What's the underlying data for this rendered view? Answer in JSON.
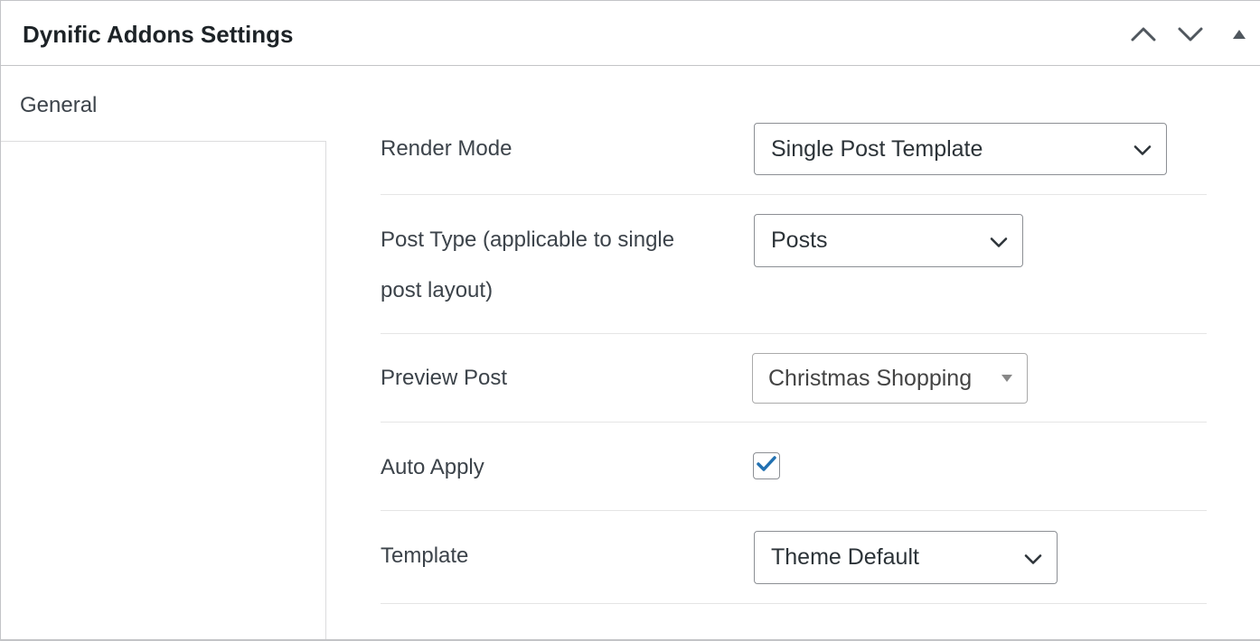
{
  "panel": {
    "title": "Dynific Addons Settings",
    "controls": {
      "up_icon": "chevron-up-icon",
      "down_icon": "chevron-down-icon",
      "toggle_icon": "triangle-up-icon"
    }
  },
  "sidebar": {
    "tabs": [
      {
        "label": "General"
      }
    ]
  },
  "settings": {
    "render_mode": {
      "label": "Render Mode",
      "value": "Single Post Template"
    },
    "post_type": {
      "label_line1": "Post Type (applicable to single",
      "label_line2": "post layout)",
      "value": "Posts"
    },
    "preview_post": {
      "label": "Preview Post",
      "value": "Christmas Shopping"
    },
    "auto_apply": {
      "label": "Auto Apply",
      "checked": true
    },
    "template": {
      "label": "Template",
      "value": "Theme Default"
    }
  },
  "colors": {
    "checkmark": "#2271b1",
    "border": "#8c8f94"
  }
}
